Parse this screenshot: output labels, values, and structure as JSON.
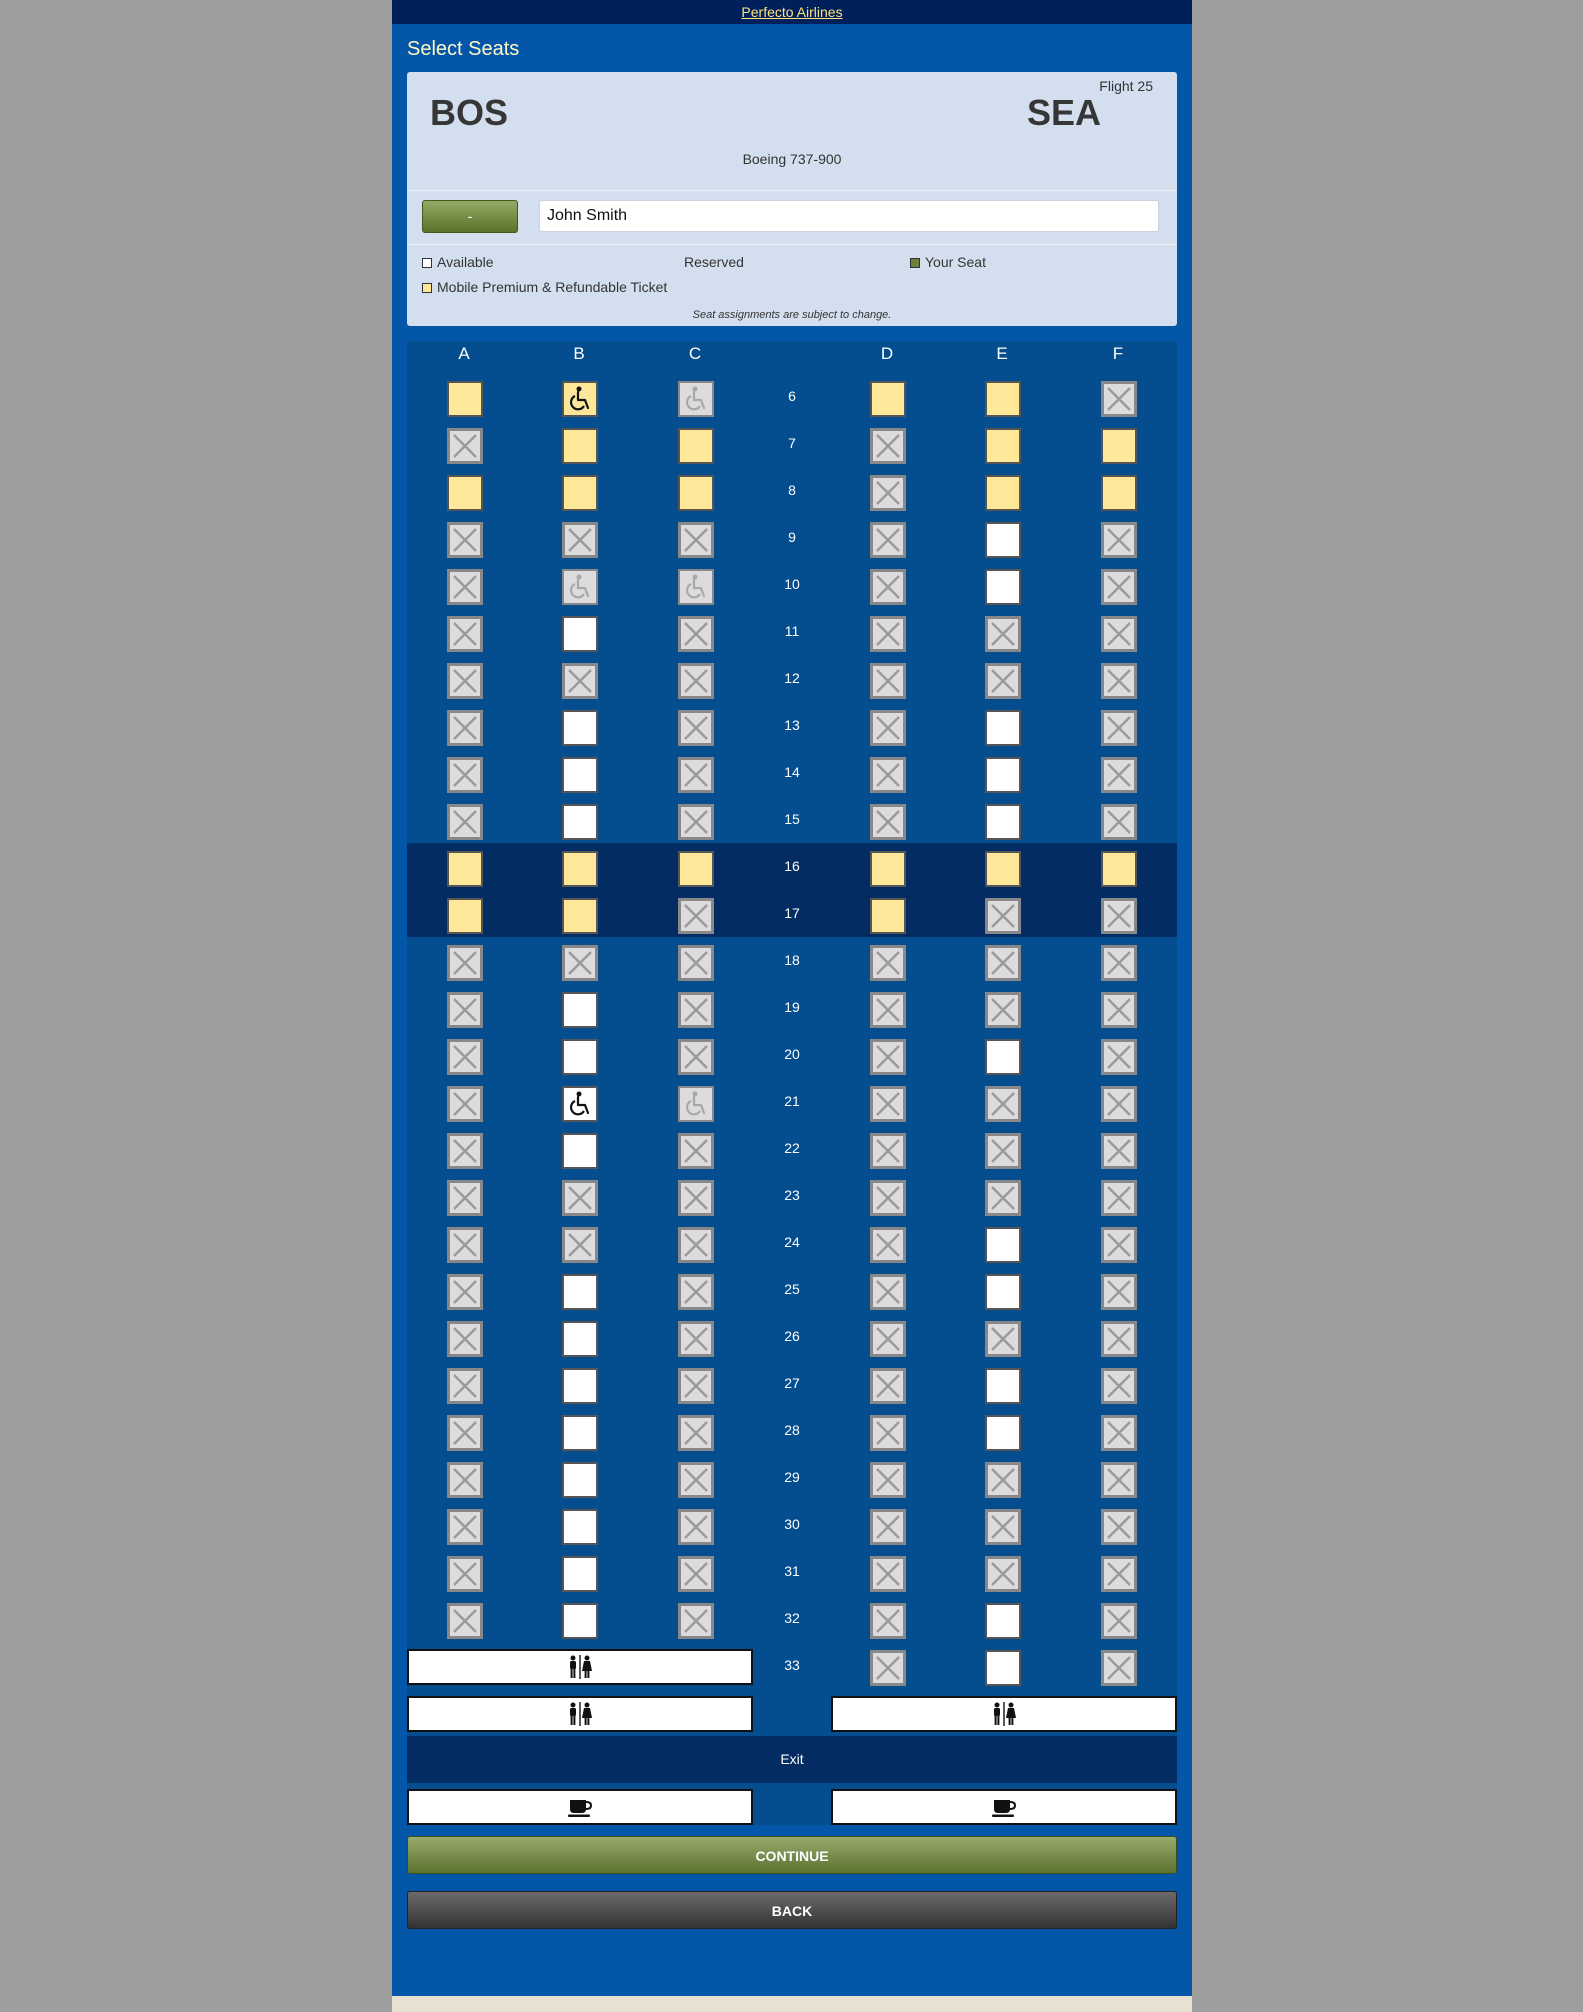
{
  "header": {
    "airline_link": "Perfecto Airlines",
    "page_title": "Select Seats"
  },
  "flight": {
    "number": "Flight 25",
    "origin": "BOS",
    "destination": "SEA",
    "aircraft": "Boeing 737-900"
  },
  "passenger": {
    "button_label": "-",
    "name": "John Smith"
  },
  "legend": {
    "available": "Available",
    "reserved": "Reserved",
    "your_seat": "Your Seat",
    "premium": "Mobile Premium & Refundable Ticket",
    "note": "Seat assignments are subject to change."
  },
  "colors": {
    "premium": "#fde89a",
    "your_seat": "#6f7f3c",
    "reserved_fill": "#dcdcdc",
    "band": "#032c63"
  },
  "seat_columns": [
    "A",
    "B",
    "C",
    "D",
    "E",
    "F"
  ],
  "seat_codes": {
    "P": "premium",
    "O": "open",
    "X": "reserved",
    "H": "accessible",
    "h": "accessible-reserved",
    "W": "accessible-premium"
  },
  "rows": [
    {
      "n": "6",
      "s": "PWhPPX"
    },
    {
      "n": "7",
      "s": "XPPXPP"
    },
    {
      "n": "8",
      "s": "PPPXPP"
    },
    {
      "n": "9",
      "s": "XXXXOX"
    },
    {
      "n": "10",
      "s": "XhhXOX"
    },
    {
      "n": "11",
      "s": "XOXXXX"
    },
    {
      "n": "12",
      "s": "XXXXXX"
    },
    {
      "n": "13",
      "s": "XOXXOX"
    },
    {
      "n": "14",
      "s": "XOXXOX"
    },
    {
      "n": "15",
      "s": "XOXXOX"
    },
    {
      "n": "16",
      "s": "PPPPPP"
    },
    {
      "n": "17",
      "s": "PPXPXX"
    },
    {
      "n": "18",
      "s": "XXXXXX"
    },
    {
      "n": "19",
      "s": "XOXXXX"
    },
    {
      "n": "20",
      "s": "XOXXOX"
    },
    {
      "n": "21",
      "s": "XHhXXX"
    },
    {
      "n": "22",
      "s": "XOXXXX"
    },
    {
      "n": "23",
      "s": "XXXXXX"
    },
    {
      "n": "24",
      "s": "XXXXOX"
    },
    {
      "n": "25",
      "s": "XOXXOX"
    },
    {
      "n": "26",
      "s": "XOXXXX"
    },
    {
      "n": "27",
      "s": "XOXXOX"
    },
    {
      "n": "28",
      "s": "XOXXOX"
    },
    {
      "n": "29",
      "s": "XOXXXX"
    },
    {
      "n": "30",
      "s": "XOXXXX"
    },
    {
      "n": "31",
      "s": "XOXXXX"
    },
    {
      "n": "32",
      "s": "XOXXOX"
    },
    {
      "n": "33",
      "s": "---XOX"
    }
  ],
  "facilities": {
    "lavatory_icon": "restroom-icon",
    "galley_icon": "coffee-cup-icon",
    "exit_label": "Exit"
  },
  "buttons": {
    "continue": "CONTINUE",
    "back": "BACK"
  }
}
